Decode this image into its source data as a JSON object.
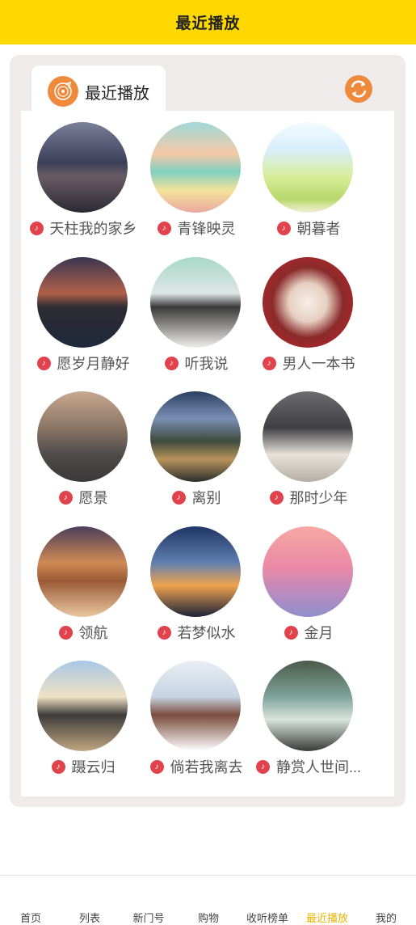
{
  "header": {
    "title": "最近播放"
  },
  "panel": {
    "tab_label": "最近播放",
    "tab_icon": "record-disc-icon",
    "refresh_icon": "refresh-icon"
  },
  "colors": {
    "accent_yellow": "#ffd800",
    "icon_orange": "#ef8a3d",
    "note_red": "#e0434b"
  },
  "items": [
    {
      "title": "天柱我的家乡",
      "image": "city-night-skyline"
    },
    {
      "title": "青锋映灵",
      "image": "pastel-landscape-painting"
    },
    {
      "title": "朝暮者",
      "image": "fantasy-rainbow-garden"
    },
    {
      "title": "愿岁月静好",
      "image": "mountain-lake-sunset"
    },
    {
      "title": "听我说",
      "image": "boy-writing-at-desk"
    },
    {
      "title": "男人一本书",
      "image": "tangyuan-bowl"
    },
    {
      "title": "愿景",
      "image": "tree-on-rock"
    },
    {
      "title": "离别",
      "image": "karst-river-sunset"
    },
    {
      "title": "那时少年",
      "image": "laptop-typing"
    },
    {
      "title": "领航",
      "image": "temple-of-heaven"
    },
    {
      "title": "若梦似水",
      "image": "tree-sunset-lake"
    },
    {
      "title": "金月",
      "image": "pink-sky-gradient"
    },
    {
      "title": "蹑云归",
      "image": "pavilion-on-water"
    },
    {
      "title": "倘若我离去",
      "image": "girl-reading"
    },
    {
      "title": "静赏人世间...",
      "image": "hanfu-lady"
    }
  ],
  "tabbar": [
    {
      "label": "首页",
      "active": false
    },
    {
      "label": "列表",
      "active": false
    },
    {
      "label": "新门号",
      "active": false
    },
    {
      "label": "购物",
      "active": false
    },
    {
      "label": "收听榜单",
      "active": false
    },
    {
      "label": "最近播放",
      "active": true
    },
    {
      "label": "我的",
      "active": false
    }
  ]
}
